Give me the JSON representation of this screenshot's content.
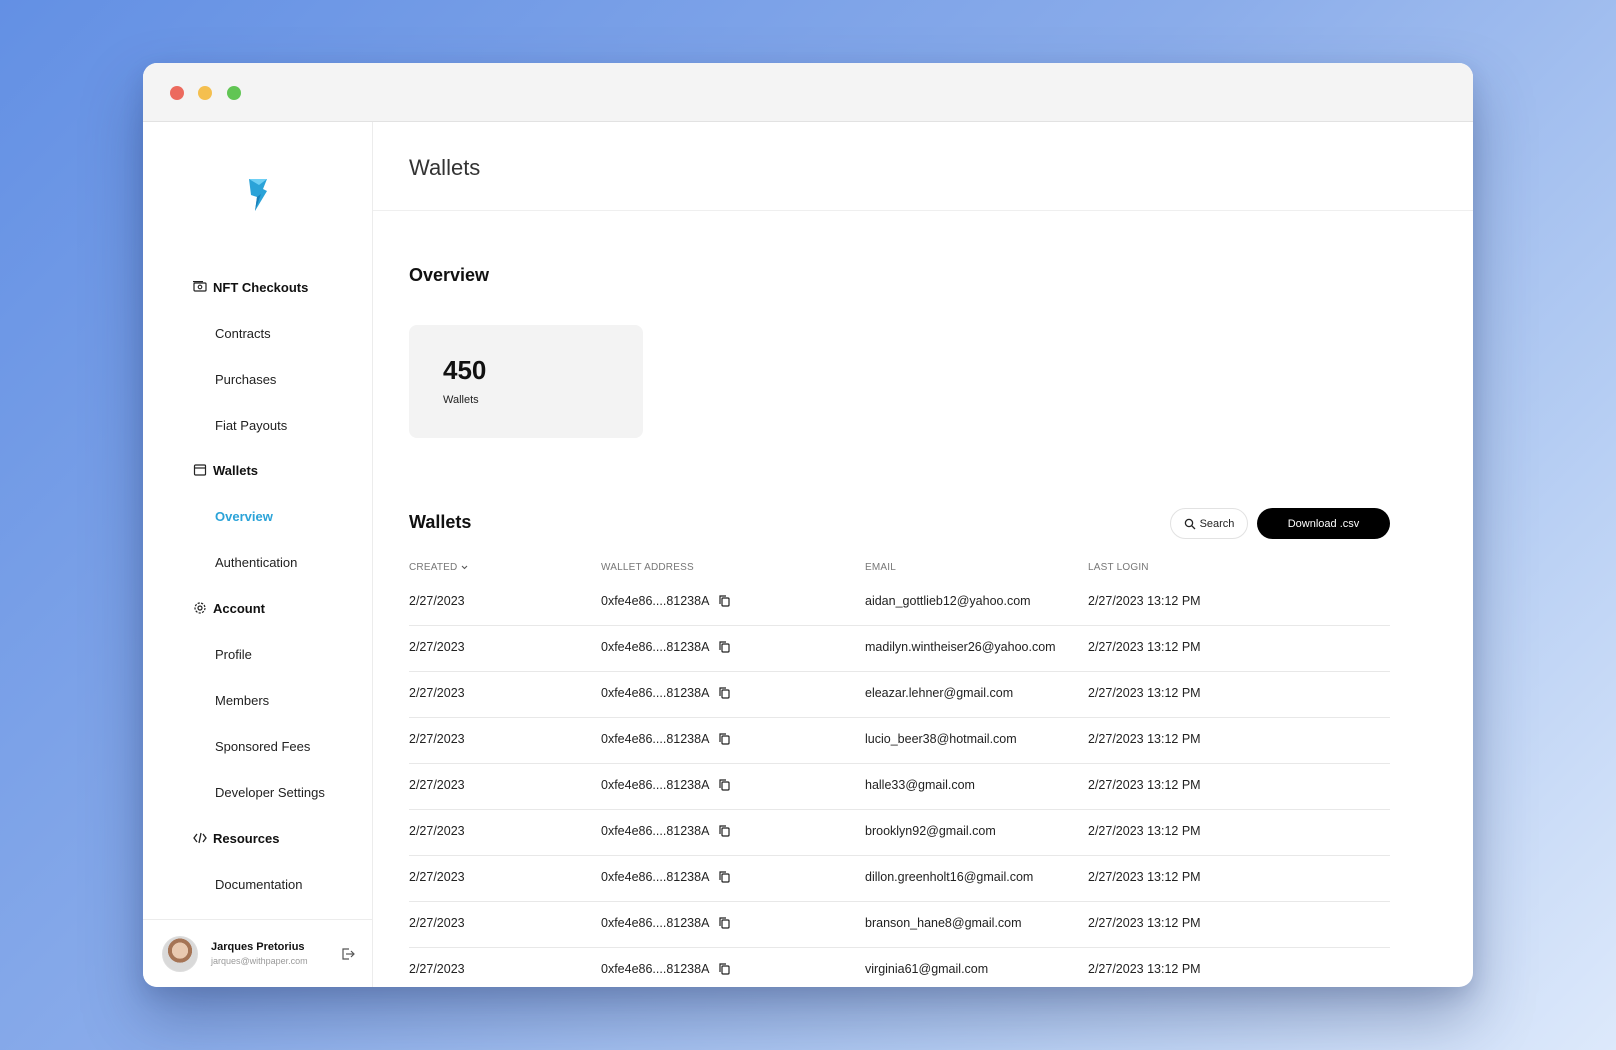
{
  "sidebar": {
    "sections": [
      {
        "label": "NFT Checkouts",
        "icon": "cash-icon",
        "items": [
          "Contracts",
          "Purchases",
          "Fiat Payouts"
        ]
      },
      {
        "label": "Wallets",
        "icon": "wallet-icon",
        "items": [
          "Overview",
          "Authentication"
        ]
      },
      {
        "label": "Account",
        "icon": "gear-icon",
        "items": [
          "Profile",
          "Members",
          "Sponsored Fees",
          "Developer Settings"
        ]
      },
      {
        "label": "Resources",
        "icon": "code-icon",
        "items": [
          "Documentation"
        ]
      }
    ],
    "active_item": "Overview",
    "user": {
      "name": "Jarques Pretorius",
      "email": "jarques@withpaper.com"
    }
  },
  "main": {
    "page_title": "Wallets",
    "overview_title": "Overview",
    "stat": {
      "value": "450",
      "label": "Wallets"
    },
    "table_title": "Wallets",
    "search_label": "Search",
    "download_label": "Download .csv",
    "columns": [
      "CREATED",
      "WALLET ADDRESS",
      "EMAIL",
      "LAST LOGIN"
    ],
    "rows": [
      {
        "created": "2/27/2023",
        "wallet": "0xfe4e86....81238A",
        "email": "aidan_gottlieb12@yahoo.com",
        "last_login": "2/27/2023  13:12 PM"
      },
      {
        "created": "2/27/2023",
        "wallet": "0xfe4e86....81238A",
        "email": "madilyn.wintheiser26@yahoo.com",
        "last_login": "2/27/2023  13:12 PM"
      },
      {
        "created": "2/27/2023",
        "wallet": "0xfe4e86....81238A",
        "email": "eleazar.lehner@gmail.com",
        "last_login": "2/27/2023  13:12 PM"
      },
      {
        "created": "2/27/2023",
        "wallet": "0xfe4e86....81238A",
        "email": "lucio_beer38@hotmail.com",
        "last_login": "2/27/2023  13:12 PM"
      },
      {
        "created": "2/27/2023",
        "wallet": "0xfe4e86....81238A",
        "email": "halle33@gmail.com",
        "last_login": "2/27/2023  13:12 PM"
      },
      {
        "created": "2/27/2023",
        "wallet": "0xfe4e86....81238A",
        "email": "brooklyn92@gmail.com",
        "last_login": "2/27/2023  13:12 PM"
      },
      {
        "created": "2/27/2023",
        "wallet": "0xfe4e86....81238A",
        "email": "dillon.greenholt16@gmail.com",
        "last_login": "2/27/2023  13:12 PM"
      },
      {
        "created": "2/27/2023",
        "wallet": "0xfe4e86....81238A",
        "email": "branson_hane8@gmail.com",
        "last_login": "2/27/2023  13:12 PM"
      },
      {
        "created": "2/27/2023",
        "wallet": "0xfe4e86....81238A",
        "email": "virginia61@gmail.com",
        "last_login": "2/27/2023  13:12 PM"
      }
    ]
  },
  "colors": {
    "accent": "#2ba3d8",
    "button": "#000000"
  }
}
